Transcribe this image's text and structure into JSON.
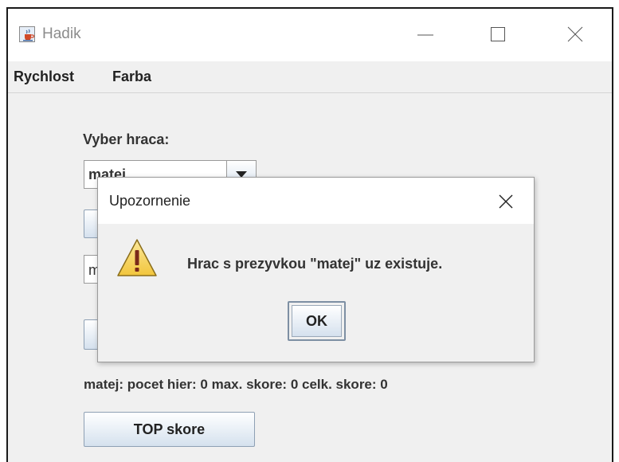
{
  "window": {
    "title": "Hadik",
    "icons": {
      "app": "java-cup-icon",
      "minimize": "minimize-icon",
      "maximize": "maximize-icon",
      "close": "close-icon"
    }
  },
  "menubar": {
    "items": [
      {
        "label": "Rychlost"
      },
      {
        "label": "Farba"
      }
    ]
  },
  "main": {
    "select_player_label": "Vyber hraca:",
    "player_combo": {
      "selected": "matej",
      "icon": "chevron-down-icon"
    },
    "name_field": {
      "value": "m"
    },
    "player_stats": "matej: pocet hier: 0 max. skore: 0 celk. skore: 0",
    "top_score_button": "TOP skore"
  },
  "dialog": {
    "title": "Upozornenie",
    "icon": "warning-icon",
    "message": "Hrac s prezyvkou \"matej\" uz existuje.",
    "ok_label": "OK"
  },
  "colors": {
    "window_bg": "#f0f0f0",
    "titlebar_bg": "#ffffff",
    "warning_yellow": "#f7d64b",
    "button_gradient_end": "#d5e1ee"
  }
}
